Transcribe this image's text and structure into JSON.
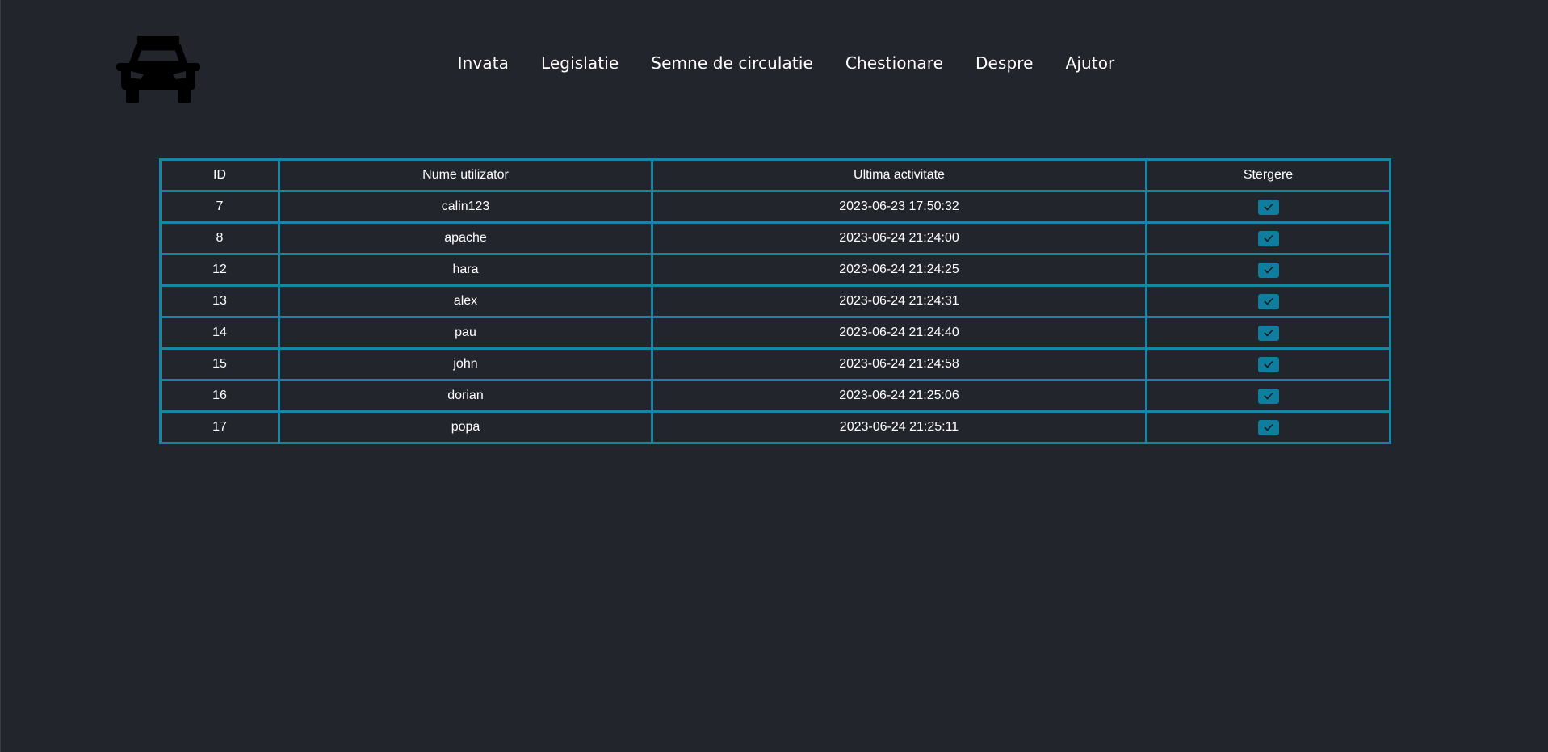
{
  "nav": {
    "items": [
      {
        "label": "Invata"
      },
      {
        "label": "Legislatie"
      },
      {
        "label": "Semne de circulatie"
      },
      {
        "label": "Chestionare"
      },
      {
        "label": "Despre"
      },
      {
        "label": "Ajutor"
      }
    ]
  },
  "logo": {
    "icon": "car-icon"
  },
  "table": {
    "headers": [
      "ID",
      "Nume utilizator",
      "Ultima activitate",
      "Stergere"
    ],
    "rows": [
      {
        "id": "7",
        "name": "calin123",
        "activity": "2023-06-23 17:50:32",
        "checked": true
      },
      {
        "id": "8",
        "name": "apache",
        "activity": "2023-06-24 21:24:00",
        "checked": true
      },
      {
        "id": "12",
        "name": "hara",
        "activity": "2023-06-24 21:24:25",
        "checked": true
      },
      {
        "id": "13",
        "name": "alex",
        "activity": "2023-06-24 21:24:31",
        "checked": true
      },
      {
        "id": "14",
        "name": "pau",
        "activity": "2023-06-24 21:24:40",
        "checked": true
      },
      {
        "id": "15",
        "name": "john",
        "activity": "2023-06-24 21:24:58",
        "checked": true
      },
      {
        "id": "16",
        "name": "dorian",
        "activity": "2023-06-24 21:25:06",
        "checked": true
      },
      {
        "id": "17",
        "name": "popa",
        "activity": "2023-06-24 21:25:11",
        "checked": true
      }
    ]
  },
  "colors": {
    "background": "#23252c",
    "accent": "#1a86a6",
    "checkbox": "#0f7e9e",
    "text": "#ffffff"
  }
}
